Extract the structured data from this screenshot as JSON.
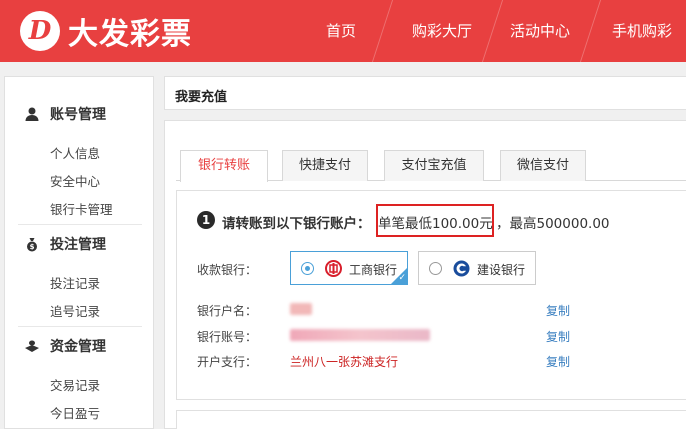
{
  "header": {
    "logo_glyph": "D",
    "logo_text": "大发彩票",
    "nav": [
      "首页",
      "购彩大厅",
      "活动中心",
      "手机购彩"
    ],
    "bg_color": "#e84040"
  },
  "sidebar": {
    "sections": [
      {
        "title": "账号管理",
        "icon": "user-icon",
        "items": [
          "个人信息",
          "安全中心",
          "银行卡管理"
        ]
      },
      {
        "title": "投注管理",
        "icon": "money-bag-icon",
        "items": [
          "投注记录",
          "追号记录"
        ]
      },
      {
        "title": "资金管理",
        "icon": "wallet-icon",
        "items": [
          "交易记录",
          "今日盈亏"
        ]
      }
    ]
  },
  "main": {
    "title": "我要充值",
    "tabs": [
      "银行转账",
      "快捷支付",
      "支付宝充值",
      "微信支付"
    ],
    "active_tab": 0,
    "step_number": "1",
    "step_text": "请转账到以下银行账户：",
    "limit_min": "单笔最低100.00元",
    "limit_max": "，最高500000.00",
    "bank_label": "收款银行：",
    "banks": [
      {
        "name": "工商银行",
        "selected": true,
        "color": "#d81e2b"
      },
      {
        "name": "建设银行",
        "selected": false,
        "color": "#1a4d9c"
      }
    ],
    "account_name_label": "银行户名：",
    "account_number_label": "银行账号：",
    "branch_label": "开户支行：",
    "branch_value": "兰州八一张苏滩支行",
    "copy_label": "复制"
  }
}
